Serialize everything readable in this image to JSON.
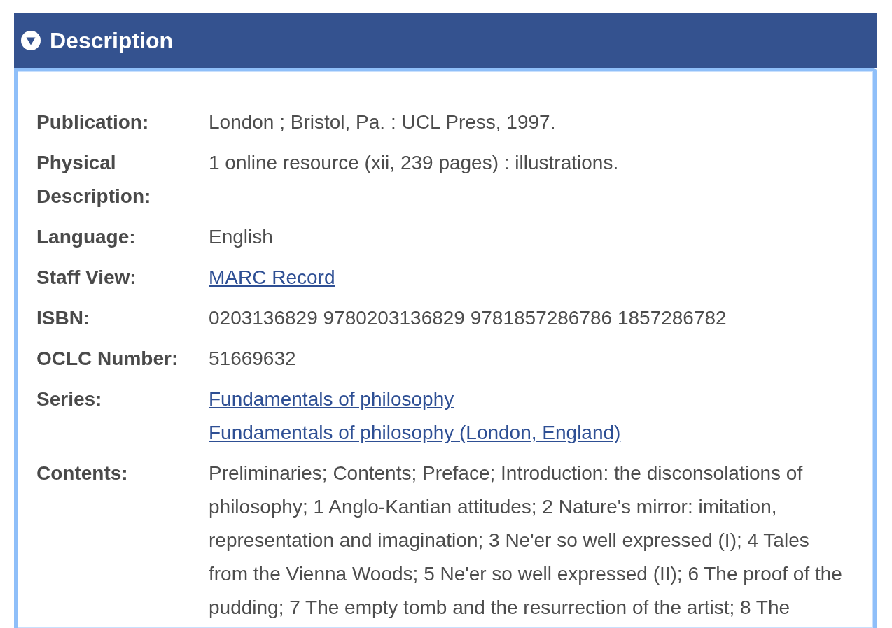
{
  "section": {
    "title": "Description",
    "expanded": true
  },
  "fields": [
    {
      "label": "Publication:",
      "values": [
        {
          "kind": "text",
          "text": "London ; Bristol, Pa. : UCL Press, 1997."
        }
      ]
    },
    {
      "label": "Physical Description:",
      "values": [
        {
          "kind": "text",
          "text": "1 online resource (xii, 239 pages) : illustrations."
        }
      ]
    },
    {
      "label": "Language:",
      "values": [
        {
          "kind": "text",
          "text": "English"
        }
      ]
    },
    {
      "label": "Staff View:",
      "values": [
        {
          "kind": "link",
          "text": "MARC Record"
        }
      ]
    },
    {
      "label": "ISBN:",
      "values": [
        {
          "kind": "text",
          "text": "0203136829 9780203136829 9781857286786 1857286782"
        }
      ]
    },
    {
      "label": "OCLC Number:",
      "values": [
        {
          "kind": "text",
          "text": "51669632"
        }
      ]
    },
    {
      "label": "Series:",
      "values": [
        {
          "kind": "link",
          "text": "Fundamentals of philosophy"
        },
        {
          "kind": "link",
          "text": "Fundamentals of philosophy (London, England)"
        }
      ]
    },
    {
      "label": "Contents:",
      "values": [
        {
          "kind": "text",
          "text": "Preliminaries; Contents; Preface; Introduction: the disconsolations of philosophy; 1 Anglo-Kantian attitudes; 2 Nature's mirror: imitation, representation and imagination; 3 Ne'er so well expressed (I); 4 Tales from the Vienna Woods; 5 Ne'er so well expressed (II); 6 The proof of the pudding; 7 The empty tomb and the resurrection of the artist; 8 The"
        }
      ]
    }
  ]
}
